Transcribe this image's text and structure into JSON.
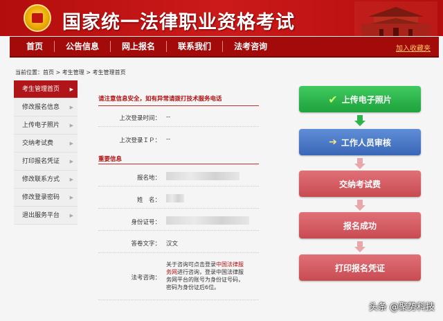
{
  "header": {
    "title": "国家统一法律职业资格考试"
  },
  "nav": {
    "items": [
      "首页",
      "公告信息",
      "网上报名",
      "联系我们",
      "法考咨询"
    ],
    "favorite": "加入收藏夹"
  },
  "breadcrumb": "当前位置：首页 > 考生管理 > 考生管理首页",
  "sidebar": {
    "items": [
      "考生管理首页",
      "修改报名信息",
      "上传电子照片",
      "交纳考试费",
      "打印报名凭证",
      "修改联系方式",
      "修改登录密码",
      "退出服务平台"
    ],
    "active_index": 0
  },
  "main": {
    "notice": "请注意信息安全，如有异常请拨打技术服务电话",
    "last_login_time_label": "上次登录时间：",
    "last_login_time_value": "--",
    "last_login_ip_label": "上次登录ＩＰ：",
    "last_login_ip_value": "--",
    "section_title": "重要信息",
    "registration_place_label": "报名地：",
    "name_label": "姓　名：",
    "id_number_label": "身份证号：",
    "answer_language_label": "答卷文字：",
    "answer_language_value": "汉文",
    "consult_label": "法考咨询：",
    "consult_text_1": "关于咨询可点击登录",
    "consult_link": "中国法律服务网",
    "consult_text_2": "进行咨询，登录中国法律服务网平台的账号为身份证号码，密码为身份证后6位。"
  },
  "flow": {
    "steps": [
      "上传电子照片",
      "工作人员审核",
      "交纳考试费",
      "报名成功",
      "打印报名凭证"
    ]
  },
  "watermark": "头条 @聚势科技",
  "colors": {
    "brand_red": "#b30d0d",
    "step_green": "#1ea23d",
    "step_blue": "#3a68b8",
    "step_red": "#c94b52"
  }
}
